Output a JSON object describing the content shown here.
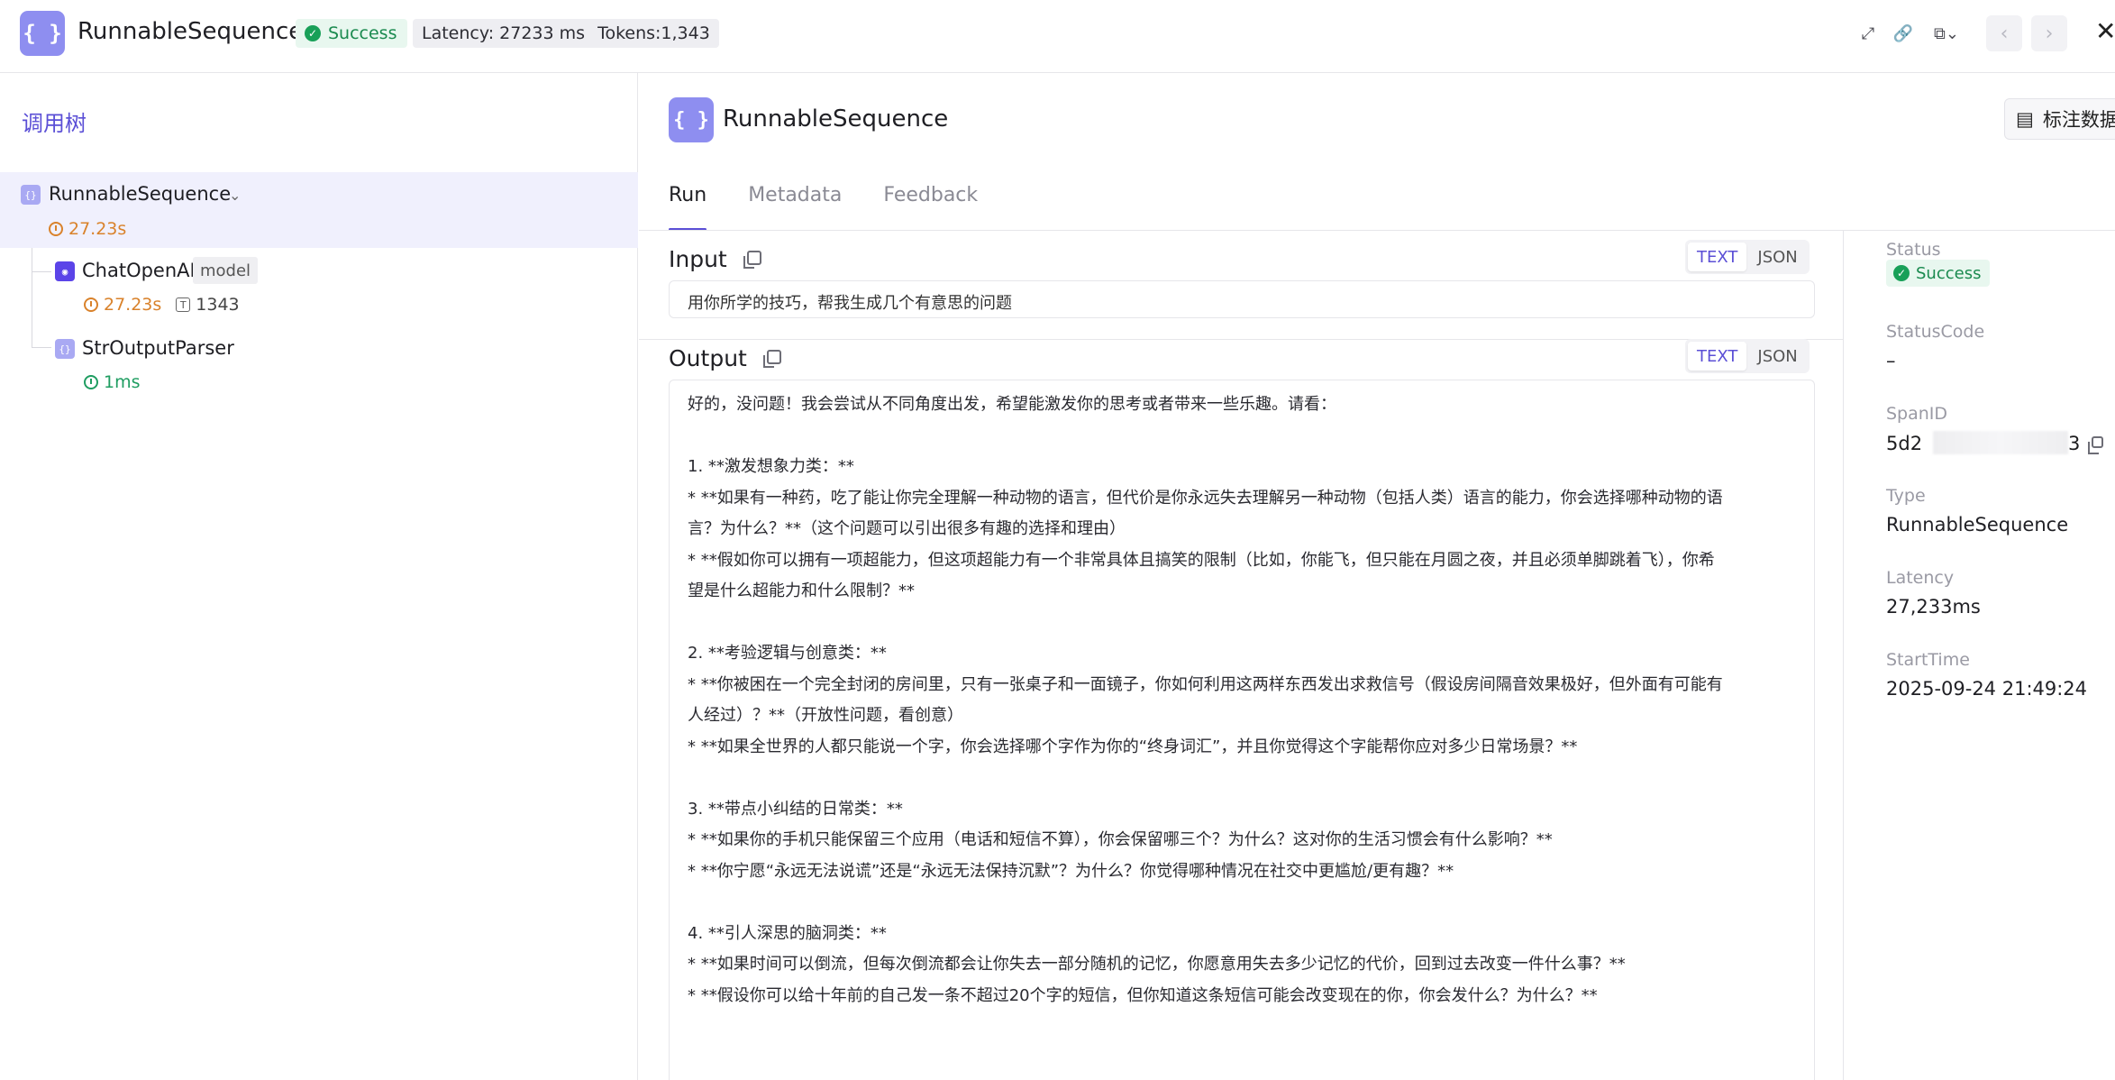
{
  "header": {
    "logo_glyph": "{ }",
    "title": "RunnableSequence",
    "status": "Success",
    "latency": "Latency: 27233 ms",
    "tokens": "Tokens:1,343",
    "icons": [
      "expand-icon",
      "link-icon",
      "copy-dropdown-icon",
      "prev-icon",
      "next-icon",
      "close-icon"
    ]
  },
  "tree": {
    "title": "调用树",
    "nodes": [
      {
        "label": "RunnableSequence",
        "icon": "{ }",
        "duration": "27.23s"
      },
      {
        "label": "ChatOpenAI",
        "tag": "model",
        "duration": "27.23s",
        "tokens": "1343"
      },
      {
        "label": "StrOutputParser",
        "icon": "{ }",
        "duration": "1ms"
      }
    ]
  },
  "main": {
    "logo_glyph": "{ }",
    "title": "RunnableSequence",
    "annotate_button": "标注数据",
    "tabs": [
      {
        "label": "Run"
      },
      {
        "label": "Metadata"
      },
      {
        "label": "Feedback"
      }
    ],
    "input": {
      "title": "Input",
      "modes": [
        "TEXT",
        "JSON"
      ],
      "text": "用你所学的技巧，帮我生成几个有意思的问题"
    },
    "output": {
      "title": "Output",
      "modes": [
        "TEXT",
        "JSON"
      ],
      "lines": [
        "好的，没问题！我会尝试从不同角度出发，希望能激发你的思考或者带来一些乐趣。请看：",
        "",
        "1. **激发想象力类：**",
        "* **如果有一种药，吃了能让你完全理解一种动物的语言，但代价是你永远失去理解另一种动物（包括人类）语言的能力，你会选择哪种动物的语",
        "言？为什么？**（这个问题可以引出很多有趣的选择和理由）",
        "* **假如你可以拥有一项超能力，但这项超能力有一个非常具体且搞笑的限制（比如，你能飞，但只能在月圆之夜，并且必须单脚跳着飞），你希",
        "望是什么超能力和什么限制？**",
        "",
        "2. **考验逻辑与创意类：**",
        "* **你被困在一个完全封闭的房间里，只有一张桌子和一面镜子，你如何利用这两样东西发出求救信号（假设房间隔音效果极好，但外面有可能有",
        "人经过）？**（开放性问题，看创意）",
        "* **如果全世界的人都只能说一个字，你会选择哪个字作为你的“终身词汇”，并且你觉得这个字能帮你应对多少日常场景？**",
        "",
        "3. **带点小纠结的日常类：**",
        "* **如果你的手机只能保留三个应用（电话和短信不算），你会保留哪三个？为什么？这对你的生活习惯会有什么影响？**",
        "* **你宁愿“永远无法说谎”还是“永远无法保持沉默”？为什么？你觉得哪种情况在社交中更尴尬/更有趣？**",
        "",
        "4. **引人深思的脑洞类：**",
        "* **如果时间可以倒流，但每次倒流都会让你失去一部分随机的记忆，你愿意用失去多少记忆的代价，回到过去改变一件什么事？**",
        "* **假设你可以给十年前的自己发一条不超过20个字的短信，但你知道这条短信可能会改变现在的你，你会发什么？为什么？**"
      ]
    }
  },
  "details": {
    "status_label": "Status",
    "status_value": "Success",
    "status_code_label": "StatusCode",
    "status_code_value": "–",
    "span_id_label": "SpanID",
    "span_id_prefix": "5d2",
    "span_id_suffix": "3",
    "type_label": "Type",
    "type_value": "RunnableSequence",
    "latency_label": "Latency",
    "latency_value": "27,233ms",
    "start_label": "StartTime",
    "start_value": "2025-09-24 21:49:24"
  },
  "colors": {
    "accent": "#5b4fd6",
    "success": "#18a058",
    "duration_warn": "#d9822b",
    "duration_ok": "#1f9d61"
  }
}
